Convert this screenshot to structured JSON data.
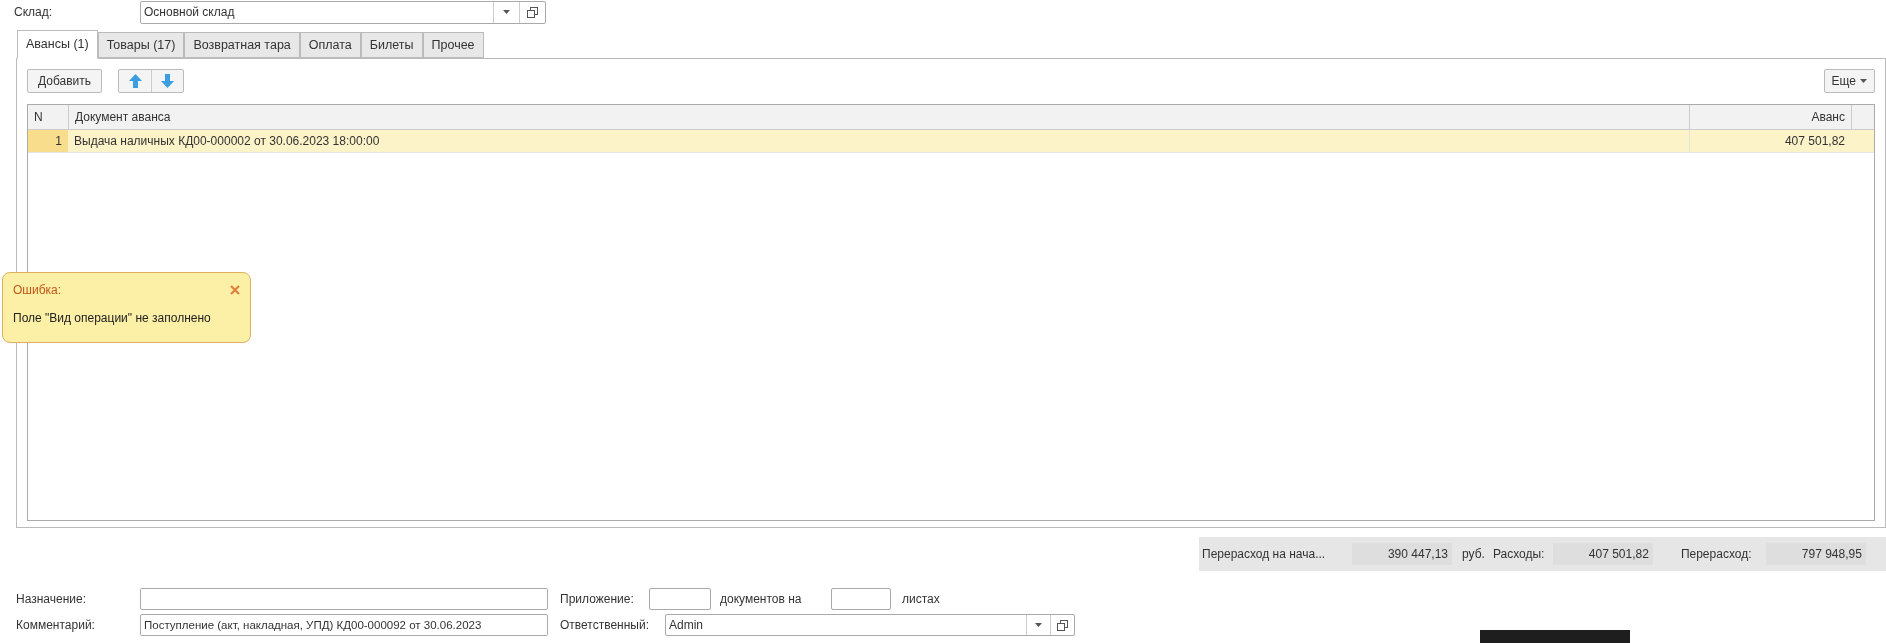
{
  "warehouse": {
    "label": "Склад:",
    "value": "Основной склад"
  },
  "tabs": [
    {
      "label": "Авансы (1)",
      "selected": true
    },
    {
      "label": "Товары (17)",
      "selected": false
    },
    {
      "label": "Возвратная тара",
      "selected": false
    },
    {
      "label": "Оплата",
      "selected": false
    },
    {
      "label": "Билеты",
      "selected": false
    },
    {
      "label": "Прочее",
      "selected": false
    }
  ],
  "toolbar": {
    "add": "Добавить",
    "more": "Еще"
  },
  "table": {
    "columns": [
      "N",
      "Документ аванса",
      "Аванс"
    ],
    "rows": [
      {
        "n": "1",
        "document": "Выдача наличных КД00-000002 от 30.06.2023 18:00:00",
        "amount": "407 501,82",
        "selected": true
      }
    ]
  },
  "error": {
    "title": "Ошибка:",
    "message": "Поле \"Вид операции\" не заполнено"
  },
  "totals": [
    {
      "label": "Перерасход на нача...",
      "value": "390 447,13",
      "unit": "руб."
    },
    {
      "label": "Расходы:",
      "value": "407 501,82"
    },
    {
      "label": "Перерасход:",
      "value": "797 948,95"
    }
  ],
  "purpose": {
    "label": "Назначение:"
  },
  "attachment": {
    "label": "Приложение:",
    "docs_label": "документов на",
    "sheets_label": "листах"
  },
  "comment": {
    "label": "Комментарий:",
    "value": "Поступление (акт, накладная, УПД) КД00-000092 от 30.06.2023"
  },
  "responsible": {
    "label": "Ответственный:",
    "value": "Admin"
  }
}
